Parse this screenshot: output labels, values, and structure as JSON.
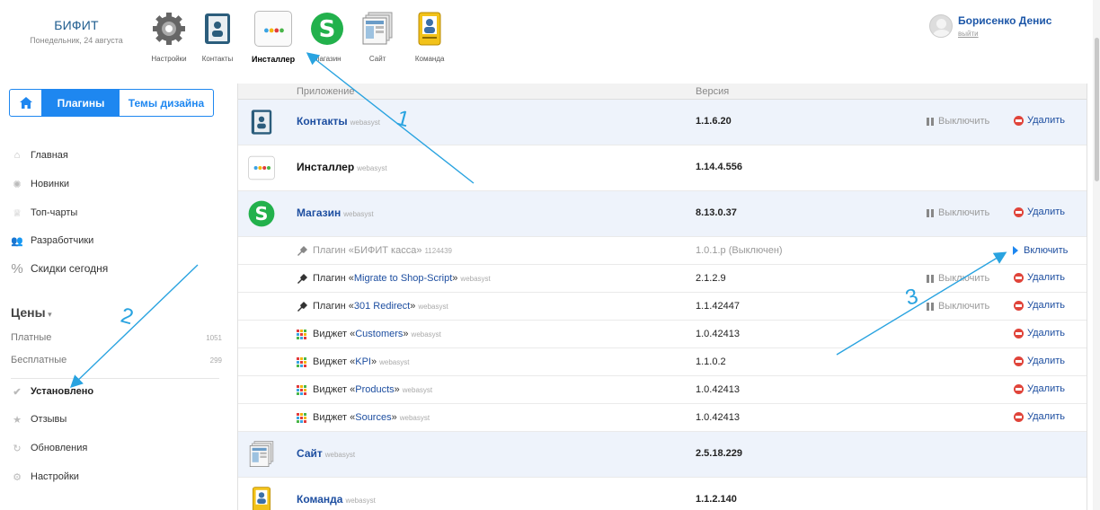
{
  "brand": {
    "name": "БИФИТ",
    "date": "Понедельник, 24 августа"
  },
  "apps": [
    {
      "label": "Настройки",
      "icon": "gear-icon"
    },
    {
      "label": "Контакты",
      "icon": "contacts-icon"
    },
    {
      "label": "Инсталлер",
      "icon": "installer-icon",
      "active": true
    },
    {
      "label": "Магазин",
      "icon": "shop-icon"
    },
    {
      "label": "Сайт",
      "icon": "site-icon"
    },
    {
      "label": "Команда",
      "icon": "team-icon"
    }
  ],
  "user": {
    "name": "Борисенко Денис",
    "logout": "выйти"
  },
  "tabs": {
    "plugins": "Плагины",
    "themes": "Темы дизайна"
  },
  "nav": {
    "main": "Главная",
    "new": "Новинки",
    "top": "Топ-чарты",
    "devs": "Разработчики",
    "sales": "Скидки сегодня",
    "prices_title": "Цены",
    "paid": "Платные",
    "paid_count": "1051",
    "free": "Бесплатные",
    "free_count": "299",
    "installed": "Установлено",
    "reviews": "Отзывы",
    "updates": "Обновления",
    "settings": "Настройки"
  },
  "table": {
    "col_app": "Приложение",
    "col_version": "Версия",
    "disable": "Выключить",
    "delete": "Удалить",
    "enable": "Включить",
    "rows": [
      {
        "title": "Контакты",
        "vendor": "webasyst",
        "version": "1.1.6.20"
      },
      {
        "title": "Инсталлер",
        "vendor": "webasyst",
        "version": "1.14.4.556"
      },
      {
        "title": "Магазин",
        "vendor": "webasyst",
        "version": "8.13.0.37"
      },
      {
        "prefix": "Плагин «",
        "name": "БИФИТ касса",
        "suffix": "»",
        "vendor": "1124439",
        "version": "1.0.1.p (Выключен)"
      },
      {
        "prefix": "Плагин «",
        "name": "Migrate to Shop-Script",
        "suffix": "»",
        "vendor": "webasyst",
        "version": "2.1.2.9"
      },
      {
        "prefix": "Плагин «",
        "name": "301 Redirect",
        "suffix": "»",
        "vendor": "webasyst",
        "version": "1.1.42447"
      },
      {
        "prefix": "Виджет «",
        "name": "Customers",
        "suffix": "»",
        "vendor": "webasyst",
        "version": "1.0.42413"
      },
      {
        "prefix": "Виджет «",
        "name": "KPI",
        "suffix": "»",
        "vendor": "webasyst",
        "version": "1.1.0.2"
      },
      {
        "prefix": "Виджет «",
        "name": "Products",
        "suffix": "»",
        "vendor": "webasyst",
        "version": "1.0.42413"
      },
      {
        "prefix": "Виджет «",
        "name": "Sources",
        "suffix": "»",
        "vendor": "webasyst",
        "version": "1.0.42413"
      },
      {
        "title": "Сайт",
        "vendor": "webasyst",
        "version": "2.5.18.229"
      },
      {
        "title": "Команда",
        "vendor": "webasyst",
        "version": "1.1.2.140"
      }
    ]
  },
  "annotations": [
    "1",
    "2",
    "3"
  ],
  "colors": {
    "accent": "#1e87f0",
    "link": "#1d4ea0",
    "danger": "#e0443a",
    "arrow": "#29a3e0"
  }
}
